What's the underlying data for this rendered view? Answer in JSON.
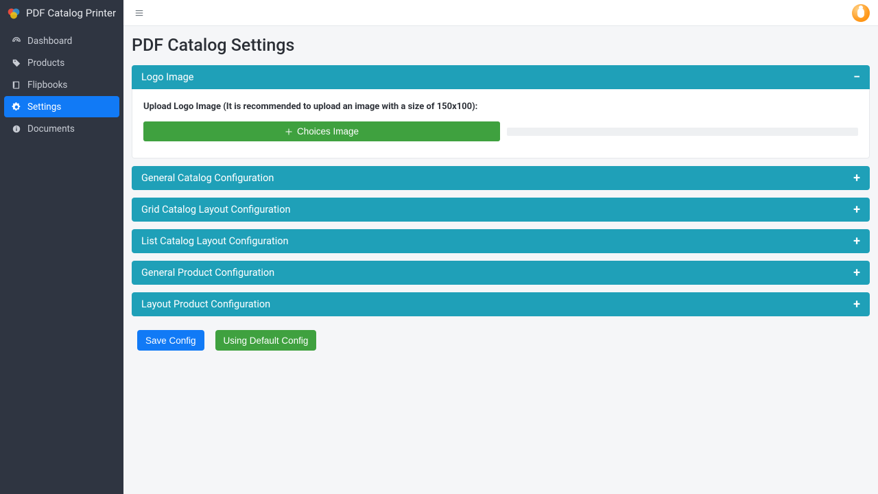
{
  "app": {
    "name": "PDF Catalog Printer"
  },
  "sidebar": {
    "items": [
      {
        "icon": "dashboard-icon",
        "label": "Dashboard"
      },
      {
        "icon": "tag-icon",
        "label": "Products"
      },
      {
        "icon": "book-icon",
        "label": "Flipbooks"
      },
      {
        "icon": "gear-icon",
        "label": "Settings",
        "active": true
      },
      {
        "icon": "info-icon",
        "label": "Documents"
      }
    ]
  },
  "page": {
    "title": "PDF Catalog Settings"
  },
  "panels": {
    "logo_image": {
      "title": "Logo Image",
      "expanded": true,
      "upload_label": "Upload Logo Image (It is recommended to upload an image with a size of 150x100):",
      "upload_button": "Choices Image"
    },
    "general_catalog": {
      "title": "General Catalog Configuration",
      "expanded": false
    },
    "grid_layout": {
      "title": "Grid Catalog Layout Configuration",
      "expanded": false
    },
    "list_layout": {
      "title": "List Catalog Layout Configuration",
      "expanded": false
    },
    "general_product": {
      "title": "General Product Configuration",
      "expanded": false
    },
    "layout_product": {
      "title": "Layout Product Configuration",
      "expanded": false
    }
  },
  "actions": {
    "save": "Save Config",
    "reset": "Using Default Config"
  },
  "colors": {
    "sidebar_bg": "#2F3541",
    "accent_blue": "#117af6",
    "panel_teal": "#1fa0b8",
    "button_green": "#3fa13f"
  }
}
